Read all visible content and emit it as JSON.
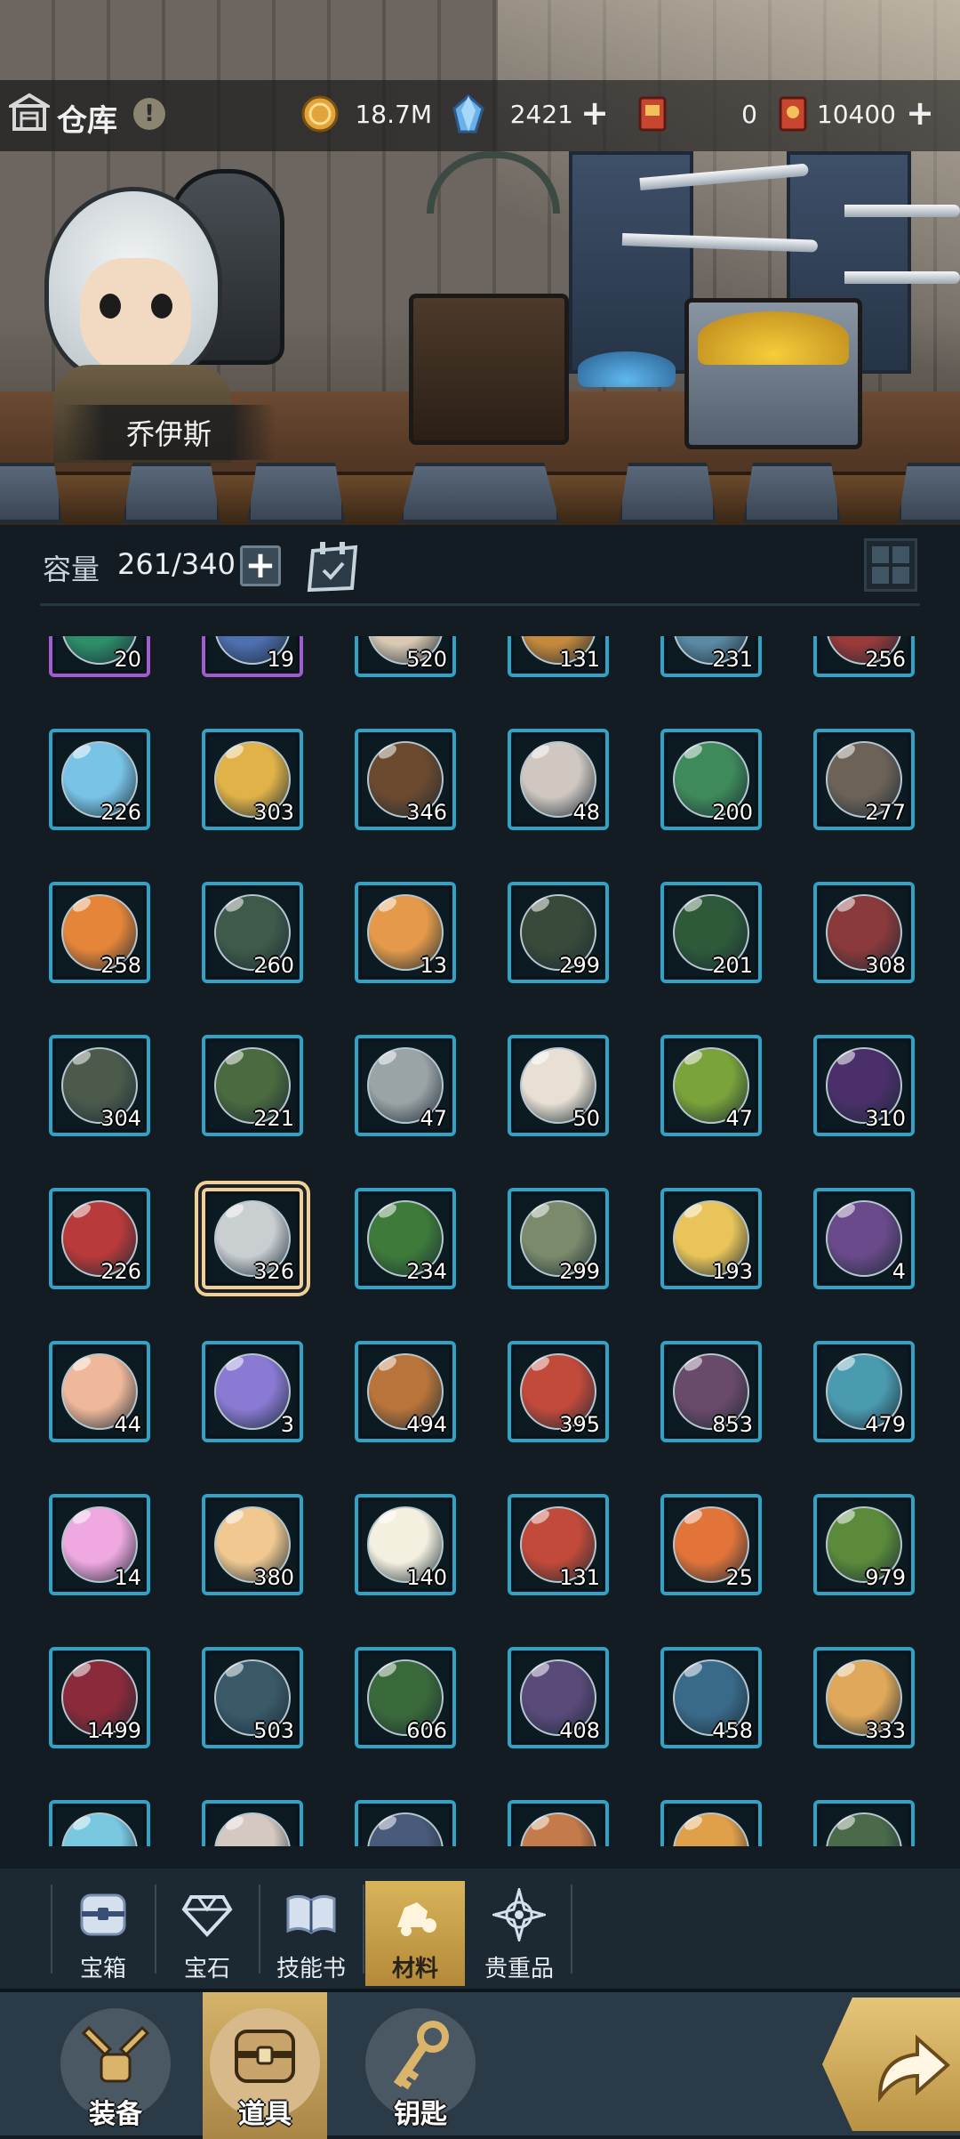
{
  "header": {
    "title": "仓库",
    "info_symbol": "!",
    "character_name": "乔伊斯",
    "resources": [
      {
        "name": "gold",
        "icon": "gold-coin-icon",
        "value": "18.7M",
        "color": "#e2a43a"
      },
      {
        "name": "gems",
        "icon": "crystal-icon",
        "value": "2421",
        "color": "#6ab1ea"
      },
      {
        "name": "ticket_a",
        "icon": "red-ticket-icon",
        "value": "0",
        "color": "#c8452f"
      },
      {
        "name": "ticket_b",
        "icon": "red-scroll-icon",
        "value": "10400",
        "color": "#c8452f"
      }
    ],
    "plus_symbol": "+"
  },
  "capacity": {
    "label": "容量",
    "value": "261/340",
    "plus_symbol": "+"
  },
  "grid": {
    "rows": [
      {
        "items": [
          {
            "count": "20",
            "color": "#2e8e6a",
            "frame": "purple"
          },
          {
            "count": "19",
            "color": "#4e6fb0",
            "frame": "purple"
          },
          {
            "count": "520",
            "color": "#d9c9b2",
            "frame": "blue"
          },
          {
            "count": "131",
            "color": "#c78a3d",
            "frame": "blue"
          },
          {
            "count": "231",
            "color": "#5b8aa3",
            "frame": "blue"
          },
          {
            "count": "256",
            "color": "#9b3a3a",
            "frame": "blue"
          }
        ]
      },
      {
        "items": [
          {
            "count": "226",
            "color": "#79c3e6",
            "frame": "blue"
          },
          {
            "count": "303",
            "color": "#e0b248",
            "frame": "blue"
          },
          {
            "count": "346",
            "color": "#6b4a2f",
            "frame": "blue"
          },
          {
            "count": "48",
            "color": "#cfc7c0",
            "frame": "blue"
          },
          {
            "count": "200",
            "color": "#3e8a5a",
            "frame": "blue"
          },
          {
            "count": "277",
            "color": "#6c6258",
            "frame": "blue"
          }
        ]
      },
      {
        "items": [
          {
            "count": "258",
            "color": "#e5853a",
            "frame": "blue"
          },
          {
            "count": "260",
            "color": "#3f5a4a",
            "frame": "blue"
          },
          {
            "count": "13",
            "color": "#e49a4a",
            "frame": "blue"
          },
          {
            "count": "299",
            "color": "#394a3a",
            "frame": "blue"
          },
          {
            "count": "201",
            "color": "#2e5a3a",
            "frame": "blue"
          },
          {
            "count": "308",
            "color": "#8a3a3a",
            "frame": "blue"
          }
        ]
      },
      {
        "items": [
          {
            "count": "304",
            "color": "#4b5a4b",
            "frame": "blue"
          },
          {
            "count": "221",
            "color": "#4a6a3f",
            "frame": "blue"
          },
          {
            "count": "47",
            "color": "#9aa3a6",
            "frame": "blue"
          },
          {
            "count": "50",
            "color": "#e8e0d4",
            "frame": "blue"
          },
          {
            "count": "47",
            "color": "#7aa33a",
            "frame": "blue"
          },
          {
            "count": "310",
            "color": "#4a2f6a",
            "frame": "blue"
          }
        ]
      },
      {
        "items": [
          {
            "count": "226",
            "color": "#b83a3a",
            "frame": "blue"
          },
          {
            "count": "326",
            "color": "#c9ced1",
            "frame": "selected"
          },
          {
            "count": "234",
            "color": "#3e7a3a",
            "frame": "blue"
          },
          {
            "count": "299",
            "color": "#7a8a6a",
            "frame": "blue"
          },
          {
            "count": "193",
            "color": "#e8c45a",
            "frame": "blue"
          },
          {
            "count": "4",
            "color": "#6a4a8a",
            "frame": "blue"
          }
        ]
      },
      {
        "items": [
          {
            "count": "44",
            "color": "#f0b89a",
            "frame": "blue"
          },
          {
            "count": "3",
            "color": "#8a7ad4",
            "frame": "blue"
          },
          {
            "count": "494",
            "color": "#b8743a",
            "frame": "blue"
          },
          {
            "count": "395",
            "color": "#c24a3a",
            "frame": "blue"
          },
          {
            "count": "853",
            "color": "#6a4a6a",
            "frame": "blue"
          },
          {
            "count": "479",
            "color": "#4a9ab0",
            "frame": "blue"
          }
        ]
      },
      {
        "items": [
          {
            "count": "14",
            "color": "#f0a8e0",
            "frame": "blue"
          },
          {
            "count": "380",
            "color": "#f0c890",
            "frame": "blue"
          },
          {
            "count": "140",
            "color": "#f4f0e0",
            "frame": "blue"
          },
          {
            "count": "131",
            "color": "#c24a3a",
            "frame": "blue"
          },
          {
            "count": "25",
            "color": "#e2743a",
            "frame": "blue"
          },
          {
            "count": "979",
            "color": "#5a8a3a",
            "frame": "blue"
          }
        ]
      },
      {
        "items": [
          {
            "count": "1499",
            "color": "#8a2a3a",
            "frame": "blue"
          },
          {
            "count": "503",
            "color": "#3a5a6a",
            "frame": "blue"
          },
          {
            "count": "606",
            "color": "#3a6a3a",
            "frame": "blue"
          },
          {
            "count": "408",
            "color": "#5a4a7a",
            "frame": "blue"
          },
          {
            "count": "458",
            "color": "#3a6a8a",
            "frame": "blue"
          },
          {
            "count": "333",
            "color": "#e0a85a",
            "frame": "blue"
          }
        ]
      },
      {
        "items": [
          {
            "count": "",
            "color": "#7ac8e0",
            "frame": "blue"
          },
          {
            "count": "",
            "color": "#d4c8c0",
            "frame": "blue"
          },
          {
            "count": "",
            "color": "#4a5a7a",
            "frame": "blue"
          },
          {
            "count": "",
            "color": "#c47a4a",
            "frame": "blue"
          },
          {
            "count": "",
            "color": "#e0a04a",
            "frame": "blue"
          },
          {
            "count": "",
            "color": "#4a6a4a",
            "frame": "blue"
          }
        ]
      }
    ]
  },
  "category_tabs": [
    {
      "label": "宝箱",
      "icon": "chest-icon",
      "active": false
    },
    {
      "label": "宝石",
      "icon": "diamond-icon",
      "active": false
    },
    {
      "label": "技能书",
      "icon": "book-icon",
      "active": false
    },
    {
      "label": "材料",
      "icon": "material-icon",
      "active": true
    },
    {
      "label": "贵重品",
      "icon": "star-compass-icon",
      "active": false
    }
  ],
  "bottom_nav": [
    {
      "label": "装备",
      "icon": "equipment-icon",
      "active": false
    },
    {
      "label": "道具",
      "icon": "item-chest-icon",
      "active": true
    },
    {
      "label": "钥匙",
      "icon": "key-icon",
      "active": false
    }
  ],
  "colors": {
    "accent_gold": "#d6b36a",
    "slot_border": "#2fa3c6",
    "background": "#141c23"
  }
}
